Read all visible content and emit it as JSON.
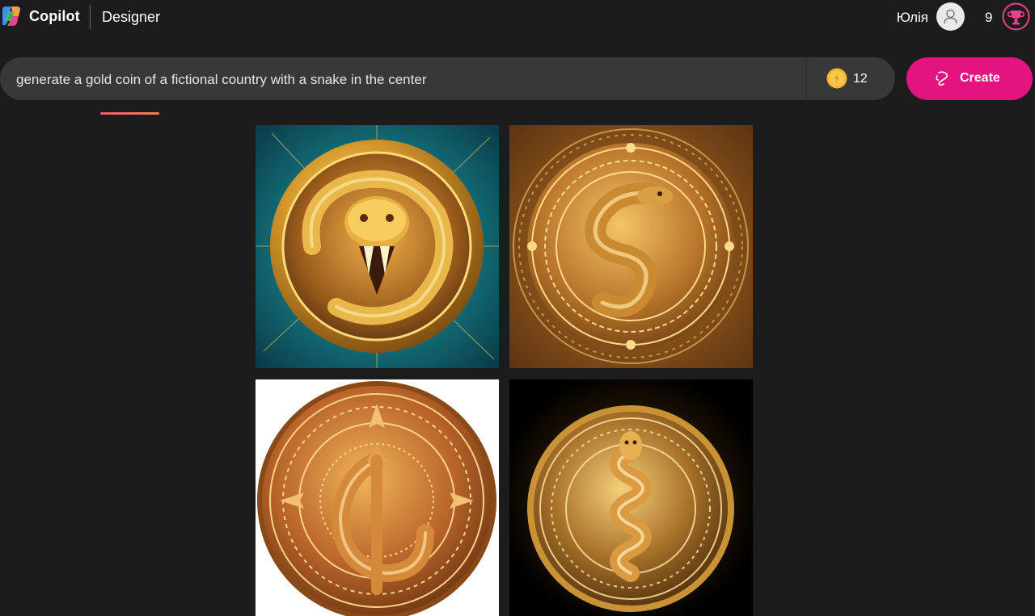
{
  "header": {
    "brand": "Copilot",
    "product": "Designer",
    "user_name": "Юлія",
    "reward_points": "9",
    "icons": {
      "logo": "copilot-logo-icon",
      "avatar": "user-avatar-icon",
      "rewards": "rewards-trophy-icon"
    }
  },
  "prompt": {
    "value": "generate a gold coin of a fictional country with a snake in the center",
    "boosts": "12",
    "boost_icon": "boost-coin-icon"
  },
  "create_button": {
    "label": "Create",
    "icon": "create-brush-icon"
  },
  "results": {
    "images": [
      {
        "subject": "snake-coin-teal-background"
      },
      {
        "subject": "snake-coin-ornate-gold"
      },
      {
        "subject": "snake-coin-white-background"
      },
      {
        "subject": "snake-coin-black-background"
      }
    ]
  },
  "colors": {
    "background": "#1c1c1c",
    "prompt_bar": "#383838",
    "accent": "#e3147f",
    "gold": "#d9a43a"
  }
}
